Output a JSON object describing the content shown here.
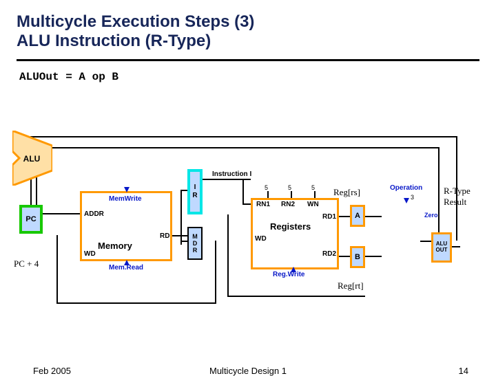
{
  "title": {
    "line1": "Multicycle Execution Steps (3)",
    "line2": "ALU Instruction (R-Type)"
  },
  "code": "ALUOut = A op B",
  "annotations": {
    "pc4": "PC + 4",
    "regrs": "Reg[rs]",
    "regrt": "Reg[rt]",
    "rtype": "R-Type\nResult"
  },
  "blocks": {
    "pc": "PC",
    "ir": "I\nR",
    "mdr": "M\nD\nR",
    "memory_title": "Memory",
    "registers_title": "Registers",
    "a": "A",
    "b": "B",
    "alu": "ALU",
    "aluout": "ALU\nOUT"
  },
  "ports": {
    "addr": "ADDR",
    "rd_mem": "RD",
    "wd_mem": "WD",
    "rn1": "RN1",
    "rn2": "RN2",
    "wn": "WN",
    "rd1": "RD1",
    "rd2": "RD2",
    "wd_reg": "WD",
    "instr": "Instruction I",
    "zero": "Zero"
  },
  "signals": {
    "memwrite": "MemWrite",
    "memread": "Mem.Read",
    "regwrite": "Reg.Write",
    "operation": "Operation"
  },
  "widths": {
    "five": "5",
    "three": "3"
  },
  "footer": {
    "date": "Feb 2005",
    "center": "Multicycle Design 1",
    "page": "14"
  }
}
